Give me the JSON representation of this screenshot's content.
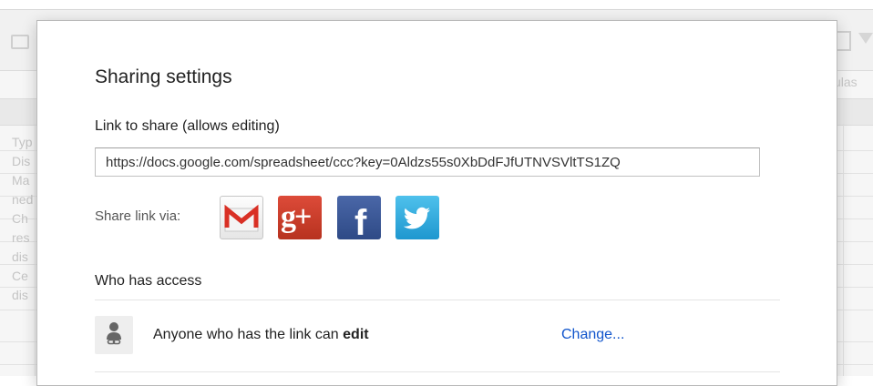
{
  "background": {
    "toolbar_partial_label": "ulas",
    "left_column_fragments": [
      "Typ",
      "Dis",
      "Ma",
      "ned",
      "Ch",
      "res",
      "dis",
      "Ce",
      "dis"
    ]
  },
  "dialog": {
    "title": "Sharing settings",
    "link_label": "Link to share (allows editing)",
    "link_url": "https://docs.google.com/spreadsheet/ccc?key=0Aldzs55s0XbDdFJfUTNVSVltTS1ZQ",
    "share_via_label": "Share link via:",
    "share_services": [
      {
        "name": "Gmail",
        "icon": "gmail-icon",
        "color": "#d93025"
      },
      {
        "name": "Google+",
        "icon": "google-plus-icon",
        "glyph": "g+",
        "color": "#dd4b39"
      },
      {
        "name": "Facebook",
        "icon": "facebook-icon",
        "glyph": "f",
        "color": "#3b5998"
      },
      {
        "name": "Twitter",
        "icon": "twitter-icon",
        "color": "#2da5dd"
      }
    ],
    "who_has_access_label": "Who has access",
    "access_entry": {
      "icon": "anyone-with-link-icon",
      "text_prefix": "Anyone who has the link can ",
      "permission": "edit",
      "change_label": "Change..."
    }
  },
  "colors": {
    "link_blue": "#1155cc"
  }
}
